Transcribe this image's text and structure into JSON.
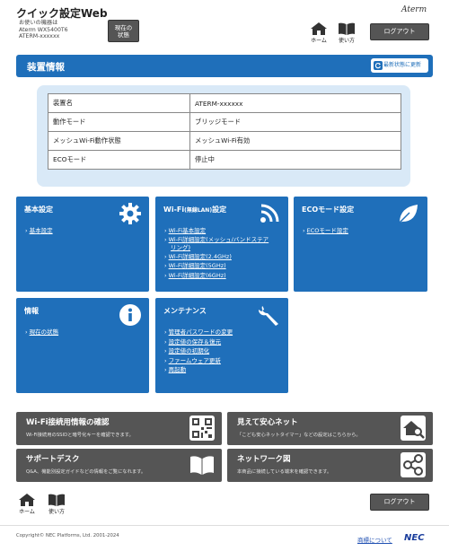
{
  "header": {
    "app_title": "クイック設定Web",
    "device_caption": "お使いの機器は",
    "device_model": "Aterm WX5400T6",
    "device_name": "ATERM-xxxxxx",
    "status_button": "現在の\n状態",
    "brand": "Aterm",
    "home_label": "ホーム",
    "help_label": "使い方",
    "logout_label": "ログアウト"
  },
  "device_info": {
    "title": "装置情報",
    "refresh_label": "最新状態に更新",
    "rows": [
      {
        "label": "装置名",
        "value": "ATERM-xxxxxx"
      },
      {
        "label": "動作モード",
        "value": "ブリッジモード"
      },
      {
        "label": "メッシュWi-Fi動作状態",
        "value": "メッシュWi-Fi有効"
      },
      {
        "label": "ECOモード",
        "value": "停止中"
      }
    ]
  },
  "tiles": {
    "basic": {
      "title": "基本設定",
      "links": [
        "基本設定"
      ]
    },
    "wifi": {
      "title": "Wi-Fi",
      "title_small": "(無線LAN)",
      "title_suffix": "設定",
      "links": [
        "Wi-Fi基本設定",
        "Wi-Fi詳細設定(メッシュ/バンドステア",
        "リング)",
        "Wi-Fi詳細設定(2.4GHz)",
        "Wi-Fi詳細設定(5GHz)",
        "Wi-Fi詳細設定(6GHz)"
      ]
    },
    "eco": {
      "title": "ECOモード設定",
      "links": [
        "ECOモード設定"
      ]
    },
    "info": {
      "title": "情報",
      "links": [
        "現在の状態"
      ]
    },
    "maintenance": {
      "title": "メンテナンス",
      "links": [
        "管理者パスワードの変更",
        "設定値の保存＆復元",
        "設定値の初期化",
        "ファームウェア更新",
        "再起動"
      ]
    }
  },
  "banners": {
    "wifi_info": {
      "title": "Wi-Fi接続用情報の確認",
      "desc": "Wi-Fi接続用のSSIDと暗号化キーを確認できます。"
    },
    "anshin": {
      "title": "見えて安心ネット",
      "desc": "「こども安心ネットタイマー」などの設定はこちらから。"
    },
    "support": {
      "title": "サポートデスク",
      "desc": "Q&A、機能別設定ガイドなどの情報をご覧になれます。"
    },
    "network_map": {
      "title": "ネットワーク図",
      "desc": "本商品に接続している端末を確認できます。"
    }
  },
  "footer": {
    "home_label": "ホーム",
    "help_label": "使い方",
    "logout_label": "ログアウト",
    "copyright": "Copyright© NEC Platforms, Ltd. 2001-2024",
    "trademark": "商標について",
    "nec": "NEC"
  },
  "colors": {
    "primary_blue": "#1f6fba",
    "dark_gray": "#555555",
    "panel_blue": "#d9e9f7"
  }
}
